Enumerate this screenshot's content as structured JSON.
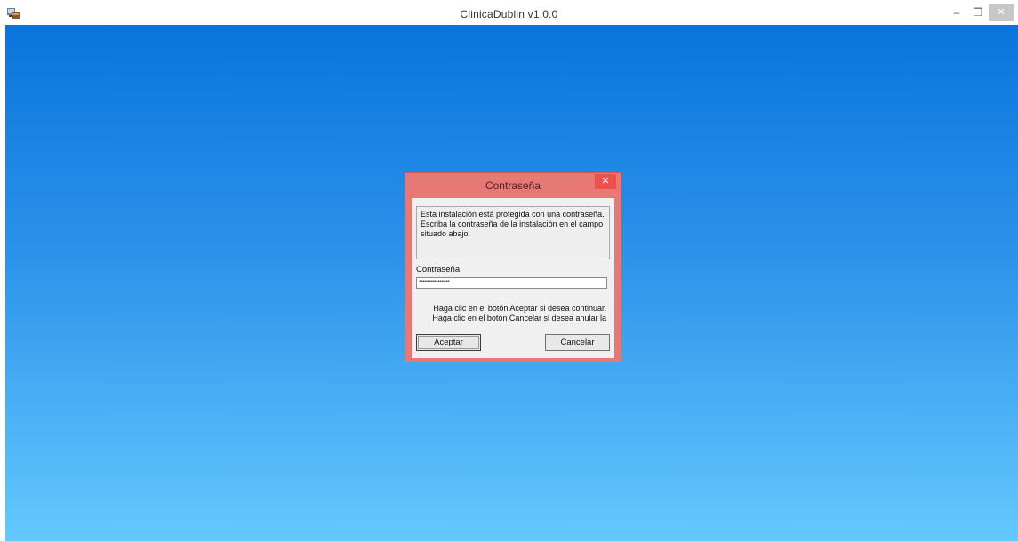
{
  "window": {
    "title": "ClinicaDublin v1.0.0",
    "icons": {
      "app": "setup-icon",
      "minimize": "minimize-icon",
      "restore": "restore-icon",
      "close": "close-icon"
    },
    "controls": {
      "minimize": "–",
      "restore": "❐",
      "close": "✕"
    }
  },
  "dialog": {
    "title": "Contraseña",
    "close_glyph": "✕",
    "info_lines": [
      "Esta instalación está protegida con una contraseña.",
      "Escriba la contraseña de la instalación en el campo",
      "situado abajo."
    ],
    "password_label": "Contraseña:",
    "password_value": "****************",
    "instructions": [
      "Haga clic en el botón Aceptar si desea continuar.",
      "Haga clic en el botón Cancelar si desea anular la"
    ],
    "ok_label": "Aceptar",
    "cancel_label": "Cancelar"
  },
  "colors": {
    "background_top": "#0a74dd",
    "background_bottom": "#64c9fd",
    "dialog_frame": "#e87876",
    "dialog_close": "#ef4f4f"
  }
}
